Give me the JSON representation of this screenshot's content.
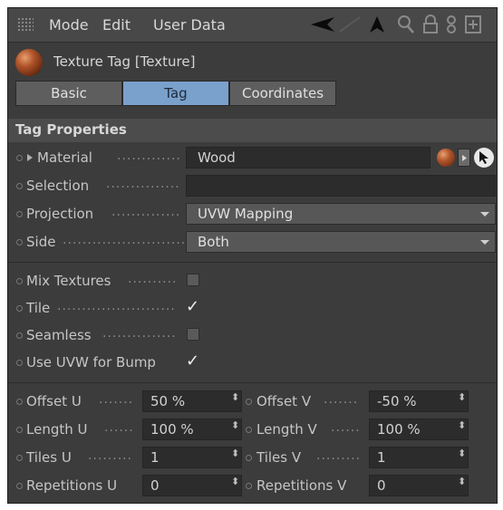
{
  "menubar": {
    "items": [
      "Mode",
      "Edit",
      "User Data"
    ]
  },
  "object": {
    "title": "Texture Tag [Texture]"
  },
  "tabs": [
    "Basic",
    "Tag",
    "Coordinates"
  ],
  "active_tab": "Tag",
  "section": {
    "title": "Tag Properties"
  },
  "properties": {
    "material": {
      "label": "Material",
      "value": "Wood"
    },
    "selection": {
      "label": "Selection",
      "value": ""
    },
    "projection": {
      "label": "Projection",
      "value": "UVW Mapping"
    },
    "side": {
      "label": "Side",
      "value": "Both"
    },
    "mix_textures": {
      "label": "Mix Textures",
      "checked": false
    },
    "tile": {
      "label": "Tile",
      "checked": true
    },
    "seamless": {
      "label": "Seamless",
      "checked": false
    },
    "use_uvw_bump": {
      "label": "Use UVW for Bump",
      "checked": true
    },
    "checkmark": "✓",
    "spinner": "⬍"
  },
  "numeric": {
    "offset_u": {
      "label": "Offset U",
      "value": "50 %"
    },
    "offset_v": {
      "label": "Offset V",
      "value": "-50 %"
    },
    "length_u": {
      "label": "Length U",
      "value": "100 %"
    },
    "length_v": {
      "label": "Length V",
      "value": "100 %"
    },
    "tiles_u": {
      "label": "Tiles U",
      "value": "1"
    },
    "tiles_v": {
      "label": "Tiles V",
      "value": "1"
    },
    "repetitions_u": {
      "label": "Repetitions U",
      "value": "0"
    },
    "repetitions_v": {
      "label": "Repetitions V",
      "value": "0"
    }
  },
  "colors": {
    "panel_bg": "#3c3c3c",
    "active_tab": "#7aa0cc",
    "field_bg": "#2c2c2c"
  }
}
